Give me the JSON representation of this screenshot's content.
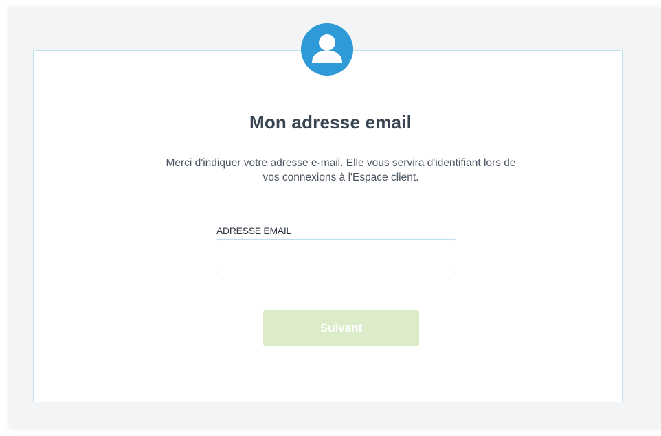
{
  "form": {
    "title": "Mon adresse email",
    "description": "Merci d'indiquer votre adresse e-mail. Elle vous servira d'identifiant lors de vos connexions à l'Espace client.",
    "email_label": "ADRESSE EMAIL",
    "email_value": "",
    "email_placeholder": "",
    "next_button_label": "Suivant"
  },
  "icons": {
    "avatar": "user-icon"
  },
  "colors": {
    "accent": "#2e9ad8",
    "title_text": "#3a4553",
    "button_disabled_bg": "#dcebc8",
    "card_border": "#bfe3ec",
    "page_background": "#f3f4f6"
  }
}
